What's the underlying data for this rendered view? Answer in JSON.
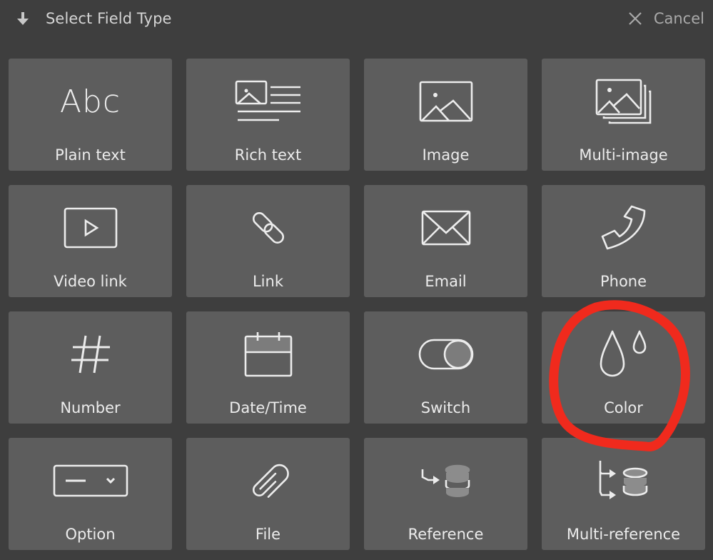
{
  "header": {
    "title": "Select Field Type",
    "title_icon": "arrow-down-icon",
    "cancel_label": "Cancel",
    "cancel_icon": "close-icon"
  },
  "field_types": [
    {
      "label": "Plain text",
      "icon": "text-abc-icon",
      "icon_text": "Abc"
    },
    {
      "label": "Rich text",
      "icon": "rich-text-icon"
    },
    {
      "label": "Image",
      "icon": "image-icon"
    },
    {
      "label": "Multi-image",
      "icon": "multi-image-icon"
    },
    {
      "label": "Video link",
      "icon": "video-play-icon"
    },
    {
      "label": "Link",
      "icon": "link-chain-icon"
    },
    {
      "label": "Email",
      "icon": "envelope-icon"
    },
    {
      "label": "Phone",
      "icon": "phone-icon"
    },
    {
      "label": "Number",
      "icon": "hash-icon"
    },
    {
      "label": "Date/Time",
      "icon": "calendar-icon"
    },
    {
      "label": "Switch",
      "icon": "toggle-switch-icon"
    },
    {
      "label": "Color",
      "icon": "color-drops-icon"
    },
    {
      "label": "Option",
      "icon": "dropdown-select-icon"
    },
    {
      "label": "File",
      "icon": "paperclip-icon"
    },
    {
      "label": "Reference",
      "icon": "reference-database-icon"
    },
    {
      "label": "Multi-reference",
      "icon": "multi-reference-database-icon"
    }
  ],
  "annotation": {
    "highlighted_item": "Color",
    "color": "#f02a1d"
  },
  "colors": {
    "background": "#3e3e3e",
    "tile": "#5d5d5d",
    "icon": "#ececec"
  }
}
